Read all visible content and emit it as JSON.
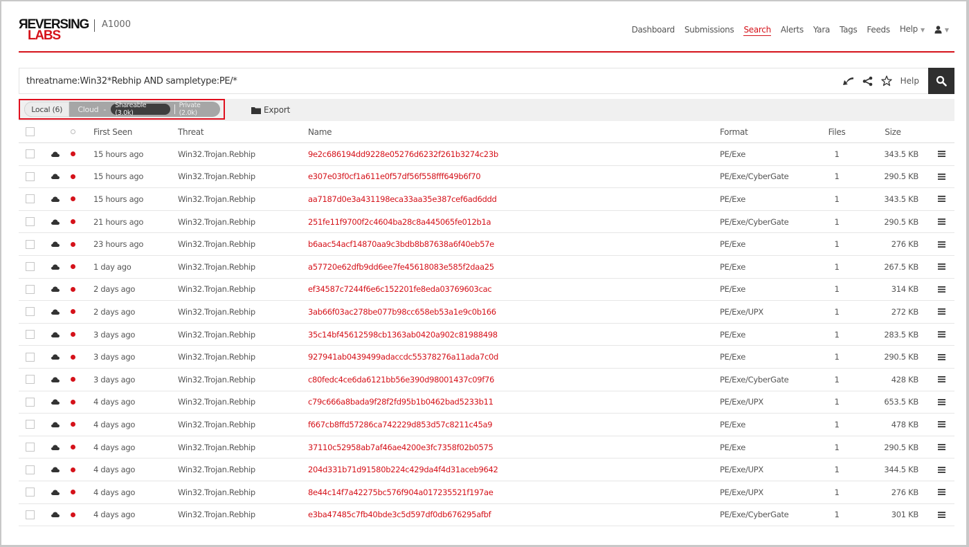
{
  "header": {
    "logo_top": "ЯEVERSING",
    "logo_bottom": "LABS",
    "product": "A1000",
    "nav": [
      {
        "label": "Dashboard",
        "active": false
      },
      {
        "label": "Submissions",
        "active": false
      },
      {
        "label": "Search",
        "active": true
      },
      {
        "label": "Alerts",
        "active": false
      },
      {
        "label": "Yara",
        "active": false
      },
      {
        "label": "Tags",
        "active": false
      },
      {
        "label": "Feeds",
        "active": false
      },
      {
        "label": "Help",
        "active": false,
        "dropdown": true
      }
    ],
    "user_icon": "user-icon",
    "accent_color": "#d5121a"
  },
  "search": {
    "value": "threatname:Win32*Rebhip AND sampletype:PE/*",
    "tools": [
      "undo-arrow-icon",
      "share-icon",
      "star-icon"
    ],
    "help_label": "Help",
    "button_icon": "search-icon"
  },
  "filters": {
    "local_label": "Local (6)",
    "cloud_label": "Cloud",
    "separator": "-",
    "shareable_label": "Shareable (3.0k)",
    "private_label": "Private (2.0k)",
    "export_label": "Export",
    "export_icon": "folder-icon"
  },
  "table": {
    "columns": {
      "first_seen": "First Seen",
      "threat": "Threat",
      "name": "Name",
      "format": "Format",
      "files": "Files",
      "size": "Size"
    },
    "rows": [
      {
        "first_seen": "15 hours ago",
        "threat": "Win32.Trojan.Rebhip",
        "name": "9e2c686194dd9228e05276d6232f261b3274c23b",
        "format": "PE/Exe",
        "files": "1",
        "size": "343.5 KB"
      },
      {
        "first_seen": "15 hours ago",
        "threat": "Win32.Trojan.Rebhip",
        "name": "e307e03f0cf1a611e0f57df56f558fff649b6f70",
        "format": "PE/Exe/CyberGate",
        "files": "1",
        "size": "290.5 KB"
      },
      {
        "first_seen": "15 hours ago",
        "threat": "Win32.Trojan.Rebhip",
        "name": "aa7187d0e3a431198eca33aa35e387cef6ad6ddd",
        "format": "PE/Exe",
        "files": "1",
        "size": "343.5 KB"
      },
      {
        "first_seen": "21 hours ago",
        "threat": "Win32.Trojan.Rebhip",
        "name": "251fe11f9700f2c4604ba28c8a445065fe012b1a",
        "format": "PE/Exe/CyberGate",
        "files": "1",
        "size": "290.5 KB"
      },
      {
        "first_seen": "23 hours ago",
        "threat": "Win32.Trojan.Rebhip",
        "name": "b6aac54acf14870aa9c3bdb8b87638a6f40eb57e",
        "format": "PE/Exe",
        "files": "1",
        "size": "276 KB"
      },
      {
        "first_seen": "1 day ago",
        "threat": "Win32.Trojan.Rebhip",
        "name": "a57720e62dfb9dd6ee7fe45618083e585f2daa25",
        "format": "PE/Exe",
        "files": "1",
        "size": "267.5 KB"
      },
      {
        "first_seen": "2 days ago",
        "threat": "Win32.Trojan.Rebhip",
        "name": "ef34587c7244f6e6c152201fe8eda03769603cac",
        "format": "PE/Exe",
        "files": "1",
        "size": "314 KB"
      },
      {
        "first_seen": "2 days ago",
        "threat": "Win32.Trojan.Rebhip",
        "name": "3ab66f03ac278be077b98cc658eb53a1e9c0b166",
        "format": "PE/Exe/UPX",
        "files": "1",
        "size": "272 KB"
      },
      {
        "first_seen": "3 days ago",
        "threat": "Win32.Trojan.Rebhip",
        "name": "35c14bf45612598cb1363ab0420a902c81988498",
        "format": "PE/Exe",
        "files": "1",
        "size": "283.5 KB"
      },
      {
        "first_seen": "3 days ago",
        "threat": "Win32.Trojan.Rebhip",
        "name": "927941ab0439499adaccdc55378276a11ada7c0d",
        "format": "PE/Exe",
        "files": "1",
        "size": "290.5 KB"
      },
      {
        "first_seen": "3 days ago",
        "threat": "Win32.Trojan.Rebhip",
        "name": "c80fedc4ce6da6121bb56e390d98001437c09f76",
        "format": "PE/Exe/CyberGate",
        "files": "1",
        "size": "428 KB"
      },
      {
        "first_seen": "4 days ago",
        "threat": "Win32.Trojan.Rebhip",
        "name": "c79c666a8bada9f28f2fd95b1b0462bad5233b11",
        "format": "PE/Exe/UPX",
        "files": "1",
        "size": "653.5 KB"
      },
      {
        "first_seen": "4 days ago",
        "threat": "Win32.Trojan.Rebhip",
        "name": "f667cb8ffd57286ca742229d853d57c8211c45a9",
        "format": "PE/Exe",
        "files": "1",
        "size": "478 KB"
      },
      {
        "first_seen": "4 days ago",
        "threat": "Win32.Trojan.Rebhip",
        "name": "37110c52958ab7af46ae4200e3fc7358f02b0575",
        "format": "PE/Exe",
        "files": "1",
        "size": "290.5 KB"
      },
      {
        "first_seen": "4 days ago",
        "threat": "Win32.Trojan.Rebhip",
        "name": "204d331b71d91580b224c429da4f4d31aceb9642",
        "format": "PE/Exe/UPX",
        "files": "1",
        "size": "344.5 KB"
      },
      {
        "first_seen": "4 days ago",
        "threat": "Win32.Trojan.Rebhip",
        "name": "8e44c14f7a42275bc576f904a017235521f197ae",
        "format": "PE/Exe/UPX",
        "files": "1",
        "size": "276 KB"
      },
      {
        "first_seen": "4 days ago",
        "threat": "Win32.Trojan.Rebhip",
        "name": "e3ba47485c7fb40bde3c5d597df0db676295afbf",
        "format": "PE/Exe/CyberGate",
        "files": "1",
        "size": "301 KB"
      }
    ],
    "row_icons": {
      "source": "cloud-icon",
      "status": "malicious-dot-icon",
      "actions": "menu-icon"
    },
    "status_color": "#d5121a"
  }
}
